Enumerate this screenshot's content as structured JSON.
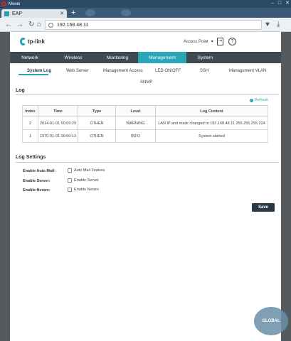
{
  "os": {
    "menu_label": "Меню"
  },
  "browser": {
    "tab_title": "EAP",
    "url": "192.168.48.11"
  },
  "header": {
    "logo_text": "tp-link",
    "mode": "Access Point"
  },
  "main_nav": [
    {
      "label": "Network"
    },
    {
      "label": "Wireless"
    },
    {
      "label": "Monitoring"
    },
    {
      "label": "Management"
    },
    {
      "label": "System"
    }
  ],
  "sub_nav": [
    {
      "label": "System Log"
    },
    {
      "label": "Web Server"
    },
    {
      "label": "Management Access"
    },
    {
      "label": "LED ON/OFF"
    },
    {
      "label": "SSH"
    },
    {
      "label": "Management VLAN"
    },
    {
      "label": "SNMP"
    }
  ],
  "log": {
    "title": "Log",
    "refresh_label": "Refresh",
    "columns": [
      "Index",
      "Time",
      "Type",
      "Level",
      "Log Content"
    ],
    "rows": [
      {
        "index": "2",
        "time": "2014-01-01 00:00:29",
        "type": "OTHER",
        "level": "WARNING",
        "content": "LAN IP and mask changed to 192.168.48.11 255.255.255.224"
      },
      {
        "index": "1",
        "time": "1970-01-01 00:00:13",
        "type": "OTHER",
        "level": "INFO",
        "content": "System started"
      }
    ]
  },
  "log_settings": {
    "title": "Log Settings",
    "items": [
      {
        "label": "Enable Auto Mail:",
        "option": "Auto Mail Feature"
      },
      {
        "label": "Enable Server:",
        "option": "Enable Server"
      },
      {
        "label": "Enable Nvram:",
        "option": "Enable Nvram"
      }
    ],
    "save_label": "Save"
  },
  "watermark": "GLOBAL"
}
